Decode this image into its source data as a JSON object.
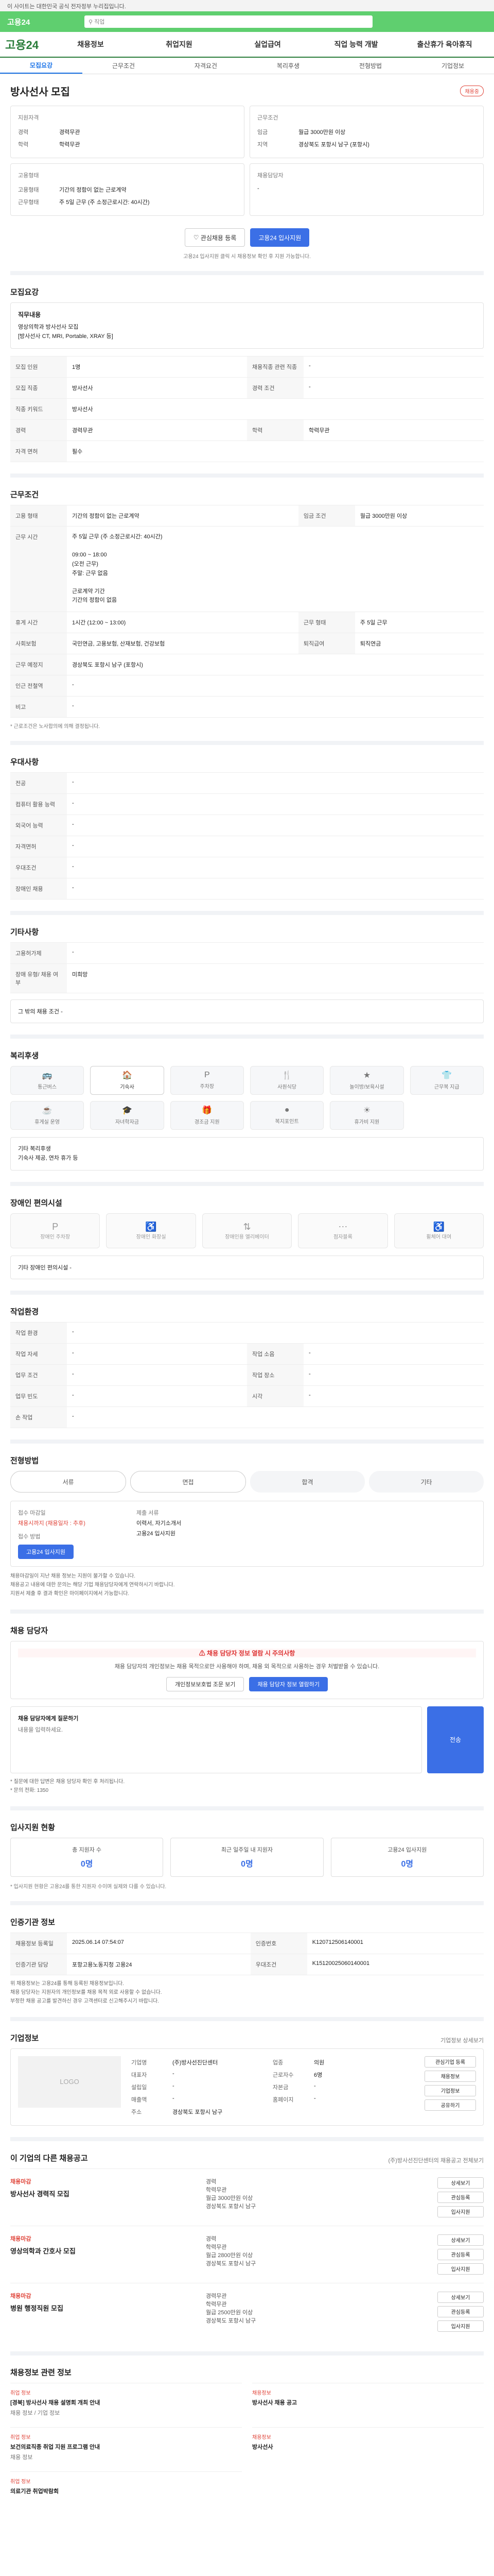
{
  "topnotice": "이 사이트는 대한민국 공식 전자정부 누리집입니다.",
  "logo": "고용24",
  "search_hint": "직업",
  "nav": {
    "brand": "고용24",
    "items": [
      "채용정보",
      "취업지원",
      "실업급여",
      "직업 능력 개발",
      "출산휴가 육아휴직"
    ]
  },
  "tabs": [
    "모집요강",
    "근무조건",
    "자격요건",
    "복리후생",
    "전형방법",
    "기업정보"
  ],
  "header": {
    "title": "방사선사 모집",
    "badge": "채용중",
    "company": {
      "label": "지원자격",
      "rows": [
        [
          "경력",
          "경력무관"
        ],
        [
          "학력",
          "학력무관"
        ]
      ]
    },
    "conditions": {
      "label": "근무조건",
      "rows": [
        [
          "임금",
          "월급 3000만원 이상"
        ],
        [
          "지역",
          "경상북도 포항시 남구 (포항시)"
        ]
      ]
    },
    "manager": {
      "label": "고용형태",
      "rows": [
        [
          "고용형태",
          "기간의 정함이 없는 근로계약"
        ],
        [
          "근무형태",
          "주 5일 근무 (주 소정근로시간: 40시간)"
        ]
      ]
    },
    "extra": {
      "label": "채용담당자",
      "rows": [
        [
          "",
          "-"
        ]
      ]
    },
    "btn_interest": "관심채용 등록",
    "btn_apply": "고용24 입사지원",
    "footnote": "고용24 입사지원 클릭 시 채용정보 확인 후 지원 가능합니다."
  },
  "recruit": {
    "title": "모집요강",
    "job_title_label": "직무내용",
    "job_desc": "영상의학과 방사선사 모집 \n[방사선사 CT, MRI, Portable, XRAY 등]",
    "rows": [
      {
        "k": "모집 인원",
        "v": "1명",
        "k2": "채용직종 관련 직종",
        "v2": "-"
      },
      {
        "k": "모집 직종",
        "v": "방사선사",
        "k2": "경력 조건",
        "v2": "-"
      },
      {
        "k": "직종 키워드",
        "v": "방사선사",
        "k2": "",
        "v2": ""
      },
      {
        "k": "경력",
        "v": "경력무관",
        "k2": "학력",
        "v2": "학력무관"
      },
      {
        "k": "자격 면허",
        "v": "필수",
        "k2": "",
        "v2": ""
      }
    ]
  },
  "work": {
    "title": "근무조건",
    "rows": [
      {
        "k": "고용 형태",
        "v": "기간의 정함이 없는 근로계약",
        "k2": "임금 조건",
        "v2": "월급 3000만원 이상"
      },
      {
        "k": "근무 시간",
        "v": "주 5일 근무 (주 소정근로시간: 40시간)\n\n09:00 ~ 18:00\n(오전 근무)\n 주말: 근무 없음\n\n근로계약 기간\n기간의 정함이 없음",
        "k2": "",
        "v2": ""
      },
      {
        "k": "휴게 시간",
        "v": "1시간 (12:00 ~ 13:00)",
        "k2": "근무 형태",
        "v2": "주 5일 근무"
      },
      {
        "k": "사회보험",
        "v": "국민연금, 고용보험, 산재보험, 건강보험",
        "k2": "퇴직급여",
        "v2": "퇴직연금"
      },
      {
        "k": "근무 예정지",
        "v": "경상북도 포항시 남구 (포항시)",
        "k2": "",
        "v2": ""
      },
      {
        "k": "인근 전철역",
        "v": "-",
        "k2": "",
        "v2": ""
      },
      {
        "k": "비고",
        "v": "-",
        "k2": "",
        "v2": ""
      }
    ],
    "note": "* 근로조건은 노사합의에 의해 결정됩니다."
  },
  "prefer": {
    "title": "우대사항",
    "rows": [
      [
        "전공",
        "-"
      ],
      [
        "컴퓨터 활용 능력",
        "-"
      ],
      [
        "외국어 능력",
        "-"
      ],
      [
        "자격면허",
        "-"
      ],
      [
        "우대조건",
        "-"
      ],
      [
        "장애인 채용",
        "-"
      ]
    ]
  },
  "other": {
    "title": "기타사항",
    "rows": [
      [
        "고용허가제",
        "-"
      ],
      [
        "장애 유형/ 채용 여부",
        "미희망"
      ]
    ],
    "extra": "그 밖의 채용 조건 -"
  },
  "welfare": {
    "title": "복리후생",
    "items": [
      {
        "name": "통근버스",
        "on": false
      },
      {
        "name": "기숙사",
        "on": true
      },
      {
        "name": "주차장",
        "on": false
      },
      {
        "name": "사원식당",
        "on": false
      },
      {
        "name": "놀이방/보육시설",
        "on": false
      },
      {
        "name": "근무복 지급",
        "on": false
      },
      {
        "name": "휴게실 운영",
        "on": false
      },
      {
        "name": "자녀학자금",
        "on": false
      },
      {
        "name": "경조금 지원",
        "on": false
      },
      {
        "name": "복지포인트",
        "on": false
      },
      {
        "name": "휴가비 지원",
        "on": false
      }
    ],
    "note": "기타 복리후생\n기숙사 제공, 연차 휴가 등"
  },
  "disabled": {
    "title": "장애인 편의시설",
    "items": [
      "장애인 주차장",
      "장애인 화장실",
      "장애인용 엘리베이터",
      "점자블록",
      "휠체어 대여"
    ],
    "note": "기타 장애인 편의시설 -"
  },
  "workplace": {
    "title": "작업환경",
    "rows": [
      [
        "작업 환경",
        "-",
        "",
        ""
      ],
      [
        "작업 자세",
        "-",
        "작업 소음",
        "-"
      ],
      [
        "업무 조건",
        "-",
        "작업 장소",
        "-"
      ],
      [
        "업무 빈도",
        "-",
        "시각",
        "-"
      ],
      [
        "손 작업",
        "-",
        "",
        ""
      ]
    ]
  },
  "process": {
    "title": "전형방법",
    "steps": [
      "서류",
      "면접",
      "합격",
      "기타"
    ],
    "apply_label": "접수 마감일",
    "apply_value": "채용시까지 (채용일자 : 추후)",
    "method_label": "접수 방법",
    "method_value": "고용24 입사지원",
    "doc_label": "제출 서류",
    "doc_value": "이력서, 자기소개서",
    "apply_btn": "고용24 입사지원",
    "notes": [
      "채용마감일이 지난 채용 정보는 지원이 불가할 수 있습니다.",
      "채용공고 내용에 대한 문의는 해당 기업 채용담당자에게 연락하시기 바랍니다.",
      "지원서 제출 후 결과 확인은 마이페이지에서 가능합니다."
    ]
  },
  "contact": {
    "title": "채용 담당자",
    "warn": "채용 담당자 정보 열람 시 주의사항",
    "body": "채용 담당자의 개인정보는 채용 목적으로만 사용해야 하며, 채용 외 목적으로 사용하는 경우 처벌받을 수 있습니다.",
    "btn1": "개인정보보호법 조문 보기",
    "btn2": "채용 담당자 정보 열람하기",
    "form_label": "채용 담당자에게 질문하기",
    "form_hint": "내용을 입력하세요.",
    "form_btn": "전송",
    "notes": [
      "* 질문에 대한 답변은 채용 담당자 확인 후 처리됩니다.",
      "* 문의 전화: 1350"
    ]
  },
  "stats": {
    "title": "입사지원 현황",
    "items": [
      {
        "label": "총 지원자 수",
        "n": "0명"
      },
      {
        "label": "최근 일주일 내 지원자",
        "n": "0명"
      },
      {
        "label": "고용24 입사지원",
        "n": "0명"
      }
    ],
    "note": "* 입사지원 현황은 고용24를 통한 지원자 수이며 실제와 다를 수 있습니다."
  },
  "reg": {
    "title": "인증기관 정보",
    "rows": [
      [
        "채용정보 등록일",
        "2025.06.14 07:54:07",
        "인증번호",
        "K120712506140001"
      ],
      [
        "인증기관 담당",
        "포항고용노동지청 고용24",
        "우대조건",
        "K15120025060140001"
      ]
    ],
    "notes": [
      "위 채용정보는 고용24를 통해 등록된 채용정보입니다.",
      "채용 담당자는 지원자의 개인정보를 채용 목적 외로 사용할 수 없습니다.",
      "부정한 채용 공고를 발견하신 경우 고객센터로 신고해주시기 바랍니다."
    ]
  },
  "company": {
    "title": "기업정보",
    "more": "기업정보 상세보기",
    "logo_text": "LOGO",
    "rows": [
      [
        "기업명",
        "(주)방사선진단센터",
        "업종",
        "의원"
      ],
      [
        "대표자",
        "-",
        "근로자수",
        "6명"
      ],
      [
        "설립일",
        "-",
        "자본금",
        "-"
      ],
      [
        "매출액",
        "-",
        "홈페이지",
        "-"
      ],
      [
        "주소",
        "경상북도 포항시 남구",
        "",
        ""
      ]
    ],
    "btns": [
      "관심기업 등록",
      "채용정보",
      "기업정보",
      "공유하기"
    ]
  },
  "related": {
    "title": "이 기업의 다른 채용공고",
    "right": "(주)방사선진단센터의 채용공고 전체보기",
    "jobs": [
      {
        "tag": "채용마감",
        "title": "방사선사 경력직 모집",
        "cond": [
          "경력",
          "학력무관",
          "월급 3000만원 이상",
          "경상북도 포항시 남구"
        ]
      },
      {
        "tag": "채용마감",
        "title": "영상의학과 간호사 모집",
        "cond": [
          "경력",
          "학력무관",
          "월급 2800만원 이상",
          "경상북도 포항시 남구"
        ]
      },
      {
        "tag": "채용마감",
        "title": "병원 행정직원 모집",
        "cond": [
          "경력무관",
          "학력무관",
          "월급 2500만원 이상",
          "경상북도 포항시 남구"
        ]
      }
    ],
    "btns": [
      "상세보기",
      "관심등록",
      "입사지원"
    ]
  },
  "news": {
    "title": "채용정보 관련 정보",
    "items": [
      {
        "t": "취업 정보",
        "title": "[경북] 방사선사 채용 설명회 개최 안내",
        "sub": "채용 정보 / 기업 정보"
      },
      {
        "t": "채용정보",
        "title": "방사선사 채용 공고",
        "sub": ""
      },
      {
        "t": "취업 정보",
        "title": "보건의료직종 취업 지원 프로그램 안내",
        "sub": "채용 정보"
      },
      {
        "t": "채용정보",
        "title": "방사선사",
        "sub": ""
      },
      {
        "t": "취업 정보",
        "title": "의료기관 취업박람회",
        "sub": ""
      }
    ]
  }
}
